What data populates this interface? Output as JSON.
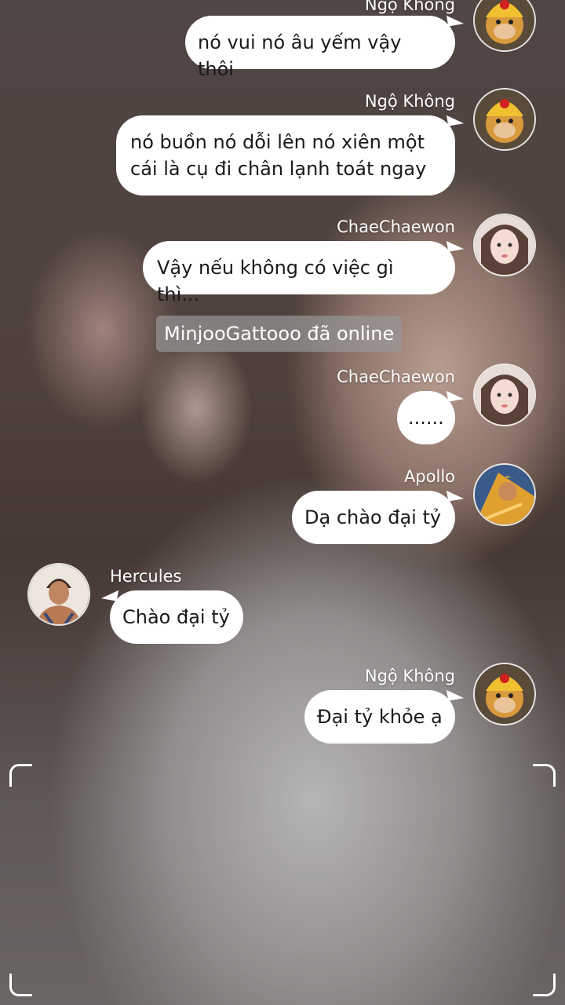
{
  "messages": [
    {
      "sender": "Ngộ Không",
      "text": "nó vui nó âu yếm vậy thôi",
      "avatar": "monkey-king-avatar"
    },
    {
      "sender": "Ngộ Không",
      "text": "nó buồn nó dỗi lên nó xiên một cái là cụ đi chân lạnh toát ngay",
      "avatar": "monkey-king-avatar"
    },
    {
      "sender": "ChaeChaewon",
      "text": "Vậy nếu không có việc gì thì...",
      "avatar": "girl-avatar"
    },
    {
      "sender": "ChaeChaewon",
      "text": "......",
      "avatar": "girl-avatar"
    },
    {
      "sender": "Apollo",
      "text": "Dạ chào đại tỷ",
      "avatar": "warrior-avatar"
    },
    {
      "sender": "Hercules",
      "text": "Chào đại tỷ",
      "avatar": "hercules-avatar"
    },
    {
      "sender": "Ngộ Không",
      "text": "Đại tỷ khỏe ạ",
      "avatar": "monkey-king-avatar"
    }
  ],
  "system_notice": "MinjooGattooo đã online",
  "colors": {
    "bubble": "#ffffff",
    "system_notice_bg": "#969696",
    "name_text": "#ffffff"
  }
}
